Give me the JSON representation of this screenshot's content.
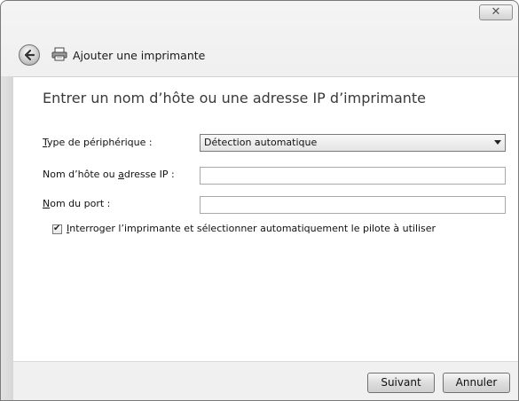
{
  "window": {
    "title": "Ajouter une imprimante",
    "close_label": "✕"
  },
  "heading": "Entrer un nom d’hôte ou une adresse IP d’imprimante",
  "form": {
    "device_type": {
      "label_ul": "T",
      "label_rest": "ype de périphérique :",
      "value": "Détection automatique"
    },
    "hostname": {
      "label_pre": "Nom d’hôte ou ",
      "label_ul": "a",
      "label_post": "dresse IP :",
      "value": ""
    },
    "port": {
      "label_ul": "N",
      "label_rest": "om du port :",
      "value": ""
    },
    "query_checkbox": {
      "checked": true,
      "label_ul": "I",
      "label_rest": "nterroger l’imprimante et sélectionner automatiquement le pilote à utiliser"
    }
  },
  "footer": {
    "next_label": "Suivant",
    "cancel_label": "Annuler"
  },
  "icons": {
    "back": "back-arrow-icon",
    "printer": "printer-icon",
    "close": "close-icon",
    "dropdown": "chevron-down-icon",
    "check": "check-mark-icon"
  }
}
